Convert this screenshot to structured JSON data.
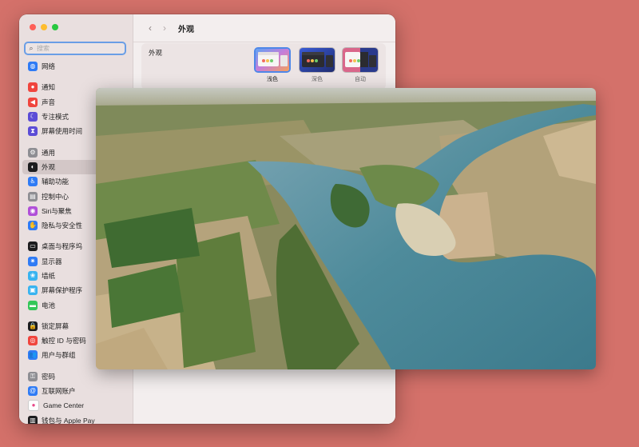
{
  "sidebar": {
    "search_placeholder": "搜索",
    "items": [
      {
        "label": "网络",
        "icon": "globe-icon",
        "color": "#2f7bf5",
        "glyph": "◍"
      },
      {
        "label": "通知",
        "icon": "bell-icon",
        "color": "#f0453d",
        "glyph": "●"
      },
      {
        "label": "声音",
        "icon": "speaker-icon",
        "color": "#f0453d",
        "glyph": "◀"
      },
      {
        "label": "专注模式",
        "icon": "moon-icon",
        "color": "#5b4cd6",
        "glyph": "☾"
      },
      {
        "label": "屏幕使用时间",
        "icon": "hourglass-icon",
        "color": "#5b4cd6",
        "glyph": "⧗"
      },
      {
        "label": "通用",
        "icon": "gear-icon",
        "color": "#8e8e93",
        "glyph": "⚙"
      },
      {
        "label": "外观",
        "icon": "appearance-icon",
        "color": "#1c1c1e",
        "glyph": "◐"
      },
      {
        "label": "辅助功能",
        "icon": "accessibility-icon",
        "color": "#2f7bf5",
        "glyph": "♿"
      },
      {
        "label": "控制中心",
        "icon": "control-center-icon",
        "color": "#8e8e93",
        "glyph": "▤"
      },
      {
        "label": "Siri与聚焦",
        "icon": "siri-icon",
        "color": "#b04fd8",
        "glyph": "◉"
      },
      {
        "label": "隐私与安全性",
        "icon": "hand-icon",
        "color": "#2f7bf5",
        "glyph": "✋"
      },
      {
        "label": "桌面与程序坞",
        "icon": "dock-icon",
        "color": "#1c1c1e",
        "glyph": "▭"
      },
      {
        "label": "显示器",
        "icon": "display-icon",
        "color": "#2f7bf5",
        "glyph": "✷"
      },
      {
        "label": "墙纸",
        "icon": "wallpaper-icon",
        "color": "#38b3f0",
        "glyph": "❀"
      },
      {
        "label": "屏幕保护程序",
        "icon": "screensaver-icon",
        "color": "#38b3f0",
        "glyph": "▣"
      },
      {
        "label": "电池",
        "icon": "battery-icon",
        "color": "#34c759",
        "glyph": "▬"
      },
      {
        "label": "锁定屏幕",
        "icon": "lock-icon",
        "color": "#1c1c1e",
        "glyph": "🔒"
      },
      {
        "label": "触控 ID 与密码",
        "icon": "fingerprint-icon",
        "color": "#f0453d",
        "glyph": "◎"
      },
      {
        "label": "用户与群组",
        "icon": "users-icon",
        "color": "#2f7bf5",
        "glyph": "👥"
      },
      {
        "label": "密码",
        "icon": "key-icon",
        "color": "#8e8e93",
        "glyph": "⚿"
      },
      {
        "label": "互联网账户",
        "icon": "at-icon",
        "color": "#2f7bf5",
        "glyph": "@"
      },
      {
        "label": "Game Center",
        "icon": "game-center-icon",
        "color": "#ffffff",
        "glyph": "●"
      },
      {
        "label": "钱包与 Apple Pay",
        "icon": "wallet-icon",
        "color": "#1c1c1e",
        "glyph": "▥"
      }
    ],
    "active_index": 6
  },
  "main": {
    "title": "外观",
    "appearance_label": "外观",
    "themes": [
      {
        "name": "浅色",
        "selected": true
      },
      {
        "name": "深色",
        "selected": false
      },
      {
        "name": "自动",
        "selected": false
      }
    ]
  }
}
